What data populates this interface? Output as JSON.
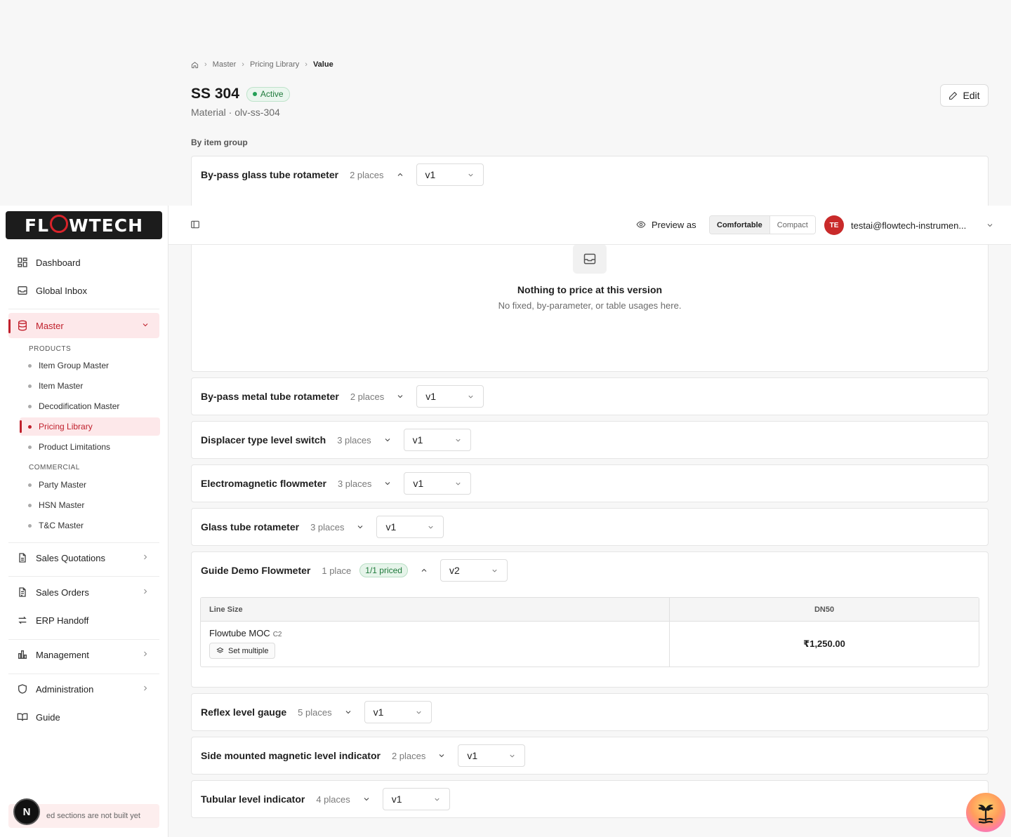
{
  "breadcrumb": {
    "items": [
      "Master",
      "Pricing Library",
      "Value"
    ]
  },
  "header": {
    "title": "SS 304",
    "status": "Active",
    "subtitle": "Material · olv-ss-304",
    "edit_label": "Edit"
  },
  "section_label": "By item group",
  "groups": [
    {
      "name": "By-pass glass tube rotameter",
      "places": "2 places",
      "version": "v1",
      "expanded": true
    },
    {
      "name": "By-pass metal tube rotameter",
      "places": "2 places",
      "version": "v1"
    },
    {
      "name": "Displacer type level switch",
      "places": "3 places",
      "version": "v1"
    },
    {
      "name": "Electromagnetic flowmeter",
      "places": "3 places",
      "version": "v1"
    },
    {
      "name": "Glass tube rotameter",
      "places": "3 places",
      "version": "v1"
    },
    {
      "name": "Guide Demo Flowmeter",
      "places": "1 place",
      "priced": "1/1 priced",
      "version": "v2",
      "expanded": true
    },
    {
      "name": "Reflex level gauge",
      "places": "5 places",
      "version": "v1"
    },
    {
      "name": "Side mounted magnetic level indicator",
      "places": "2 places",
      "version": "v1"
    },
    {
      "name": "Tubular level indicator",
      "places": "4 places",
      "version": "v1"
    }
  ],
  "empty_state": {
    "title": "Nothing to price at this version",
    "subtitle": "No fixed, by-parameter, or table usages here."
  },
  "price_table": {
    "col1": "Line Size",
    "col2": "DN50",
    "row_name": "Flowtube MOC",
    "row_tag": "C2",
    "set_multiple": "Set multiple",
    "value": "₹1,250.00"
  },
  "topbar": {
    "preview_label": "Preview as",
    "density": [
      "Comfortable",
      "Compact"
    ],
    "density_selected": "Comfortable",
    "user_initials": "TE",
    "user_email": "testai@flowtech-instrumen..."
  },
  "sidebar": {
    "brand": {
      "left": "FL",
      "right": "WTECH"
    },
    "items": {
      "dashboard": "Dashboard",
      "global_inbox": "Global Inbox",
      "master": "Master",
      "products_head": "PRODUCTS",
      "item_group_master": "Item Group Master",
      "item_master": "Item Master",
      "decodification_master": "Decodification Master",
      "pricing_library": "Pricing Library",
      "product_limitations": "Product Limitations",
      "commercial_head": "COMMERCIAL",
      "party_master": "Party Master",
      "hsn_master": "HSN Master",
      "tc_master": "T&C Master",
      "sales_quotations": "Sales Quotations",
      "sales_orders": "Sales Orders",
      "erp_handoff": "ERP Handoff",
      "management": "Management",
      "administration": "Administration",
      "guide": "Guide"
    },
    "footnote": "ed sections are not built yet",
    "bubble": "N"
  },
  "colors": {
    "accent": "#c0202c",
    "success": "#1f7a3b"
  }
}
